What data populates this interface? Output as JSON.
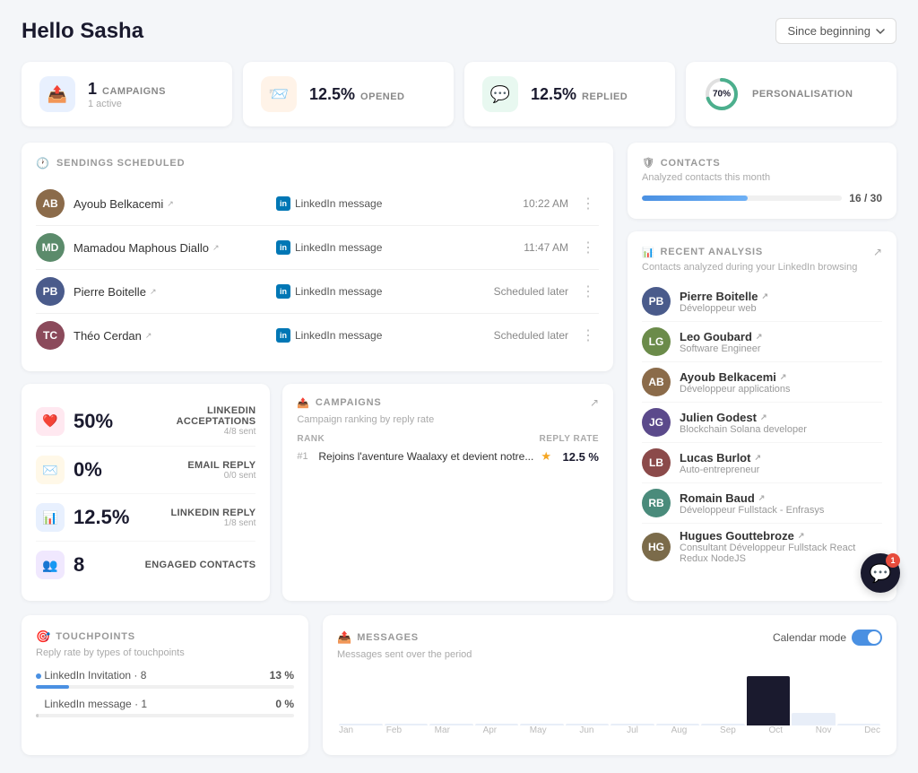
{
  "header": {
    "greeting": "Hello Sasha",
    "dropdown_label": "Since beginning",
    "dropdown_arrow": "▼"
  },
  "stats": [
    {
      "id": "campaigns",
      "icon": "📤",
      "icon_color": "blue",
      "value": "1",
      "label": "CAMPAIGNS",
      "sub": "1 active"
    },
    {
      "id": "opened",
      "icon": "📨",
      "icon_color": "orange",
      "value": "12.5%",
      "label": "OPENED",
      "sub": ""
    },
    {
      "id": "replied",
      "icon": "💬",
      "icon_color": "green",
      "value": "12.5%",
      "label": "REPLIED",
      "sub": ""
    },
    {
      "id": "personalisation",
      "icon_color": "circle",
      "value": "70%",
      "label": "PERSONALISATION",
      "sub": "",
      "circle_pct": 70
    }
  ],
  "sendings": {
    "title": "SENDINGS SCHEDULED",
    "rows": [
      {
        "name": "Ayoub Belkacemi",
        "type": "LinkedIn message",
        "time": "10:22 AM",
        "avatar_color": "#8B6B4A",
        "initials": "AB"
      },
      {
        "name": "Mamadou Maphous Diallo",
        "type": "LinkedIn message",
        "time": "11:47 AM",
        "avatar_color": "#5B8B6B",
        "initials": "MD"
      },
      {
        "name": "Pierre Boitelle",
        "type": "LinkedIn message",
        "time": "Scheduled later",
        "avatar_color": "#4A5B8B",
        "initials": "PB"
      },
      {
        "name": "Théo Cerdan",
        "type": "LinkedIn message",
        "time": "Scheduled later",
        "avatar_color": "#8B4A5B",
        "initials": "TC"
      }
    ]
  },
  "metrics": [
    {
      "icon": "❤️",
      "icon_color": "pink",
      "value": "50%",
      "label": "LINKEDIN ACCEPTATIONS",
      "sub": "4/8 sent"
    },
    {
      "icon": "✉️",
      "icon_color": "yellow",
      "value": "0%",
      "label": "EMAIL REPLY",
      "sub": "0/0 sent"
    },
    {
      "icon": "📊",
      "icon_color": "blue-light",
      "value": "12.5%",
      "label": "LINKEDIN REPLY",
      "sub": "1/8 sent"
    },
    {
      "icon": "👥",
      "icon_color": "purple",
      "value": "8",
      "label": "ENGAGED CONTACTS",
      "sub": ""
    }
  ],
  "campaigns_widget": {
    "title": "CAMPAIGNS",
    "sub": "Campaign ranking by reply rate",
    "rank_col": "RANK",
    "rate_col": "REPLY RATE",
    "items": [
      {
        "rank": "#1",
        "name": "Rejoins l'aventure Waalaxy et devient notre...",
        "rate": "12.5 %"
      }
    ]
  },
  "contacts": {
    "title": "CONTACTS",
    "sub": "Analyzed contacts this month",
    "current": 16,
    "total": 30,
    "progress_pct": 53
  },
  "recent_analysis": {
    "title": "RECENT ANALYSIS",
    "sub": "Contacts analyzed during your LinkedIn browsing",
    "people": [
      {
        "name": "Pierre Boitelle",
        "role": "Développeur web",
        "avatar_color": "#4A5B8B",
        "initials": "PB"
      },
      {
        "name": "Leo Goubard",
        "role": "Software Engineer",
        "avatar_color": "#6B8B4A",
        "initials": "LG"
      },
      {
        "name": "Ayoub Belkacemi",
        "role": "Développeur applications",
        "avatar_color": "#8B6B4A",
        "initials": "AB"
      },
      {
        "name": "Julien Godest",
        "role": "Blockchain Solana developer",
        "avatar_color": "#5B4A8B",
        "initials": "JG"
      },
      {
        "name": "Lucas Burlot",
        "role": "Auto-entrepreneur",
        "avatar_color": "#8B4A4A",
        "initials": "LB"
      },
      {
        "name": "Romain Baud",
        "role": "Développeur Fullstack - Enfrasys",
        "avatar_color": "#4A8B7B",
        "initials": "RB"
      },
      {
        "name": "Hugues Gouttebroze",
        "role": "Consultant Développeur Fullstack React Redux NodeJS",
        "avatar_color": "#7B6B4A",
        "initials": "HG"
      }
    ]
  },
  "touchpoints": {
    "title": "TOUCHPOINTS",
    "sub": "Reply rate by types of touchpoints",
    "items": [
      {
        "label": "LinkedIn Invitation",
        "count": 8,
        "value": "13 %",
        "bar_pct": 13,
        "color": "blue"
      },
      {
        "label": "LinkedIn message",
        "count": 1,
        "value": "0 %",
        "bar_pct": 0,
        "color": "gray"
      }
    ]
  },
  "messages": {
    "title": "MESSAGES",
    "sub": "Messages sent over the period",
    "calendar_mode_label": "Calendar mode",
    "months": [
      "Jan",
      "Feb",
      "Mar",
      "Apr",
      "May",
      "Jun",
      "Jul",
      "Aug",
      "Sep",
      "Oct",
      "Nov",
      "Dec"
    ],
    "bars": [
      0,
      0,
      0,
      0,
      0,
      0,
      0,
      0,
      0,
      8,
      2,
      0
    ]
  },
  "chat": {
    "badge": "1"
  }
}
